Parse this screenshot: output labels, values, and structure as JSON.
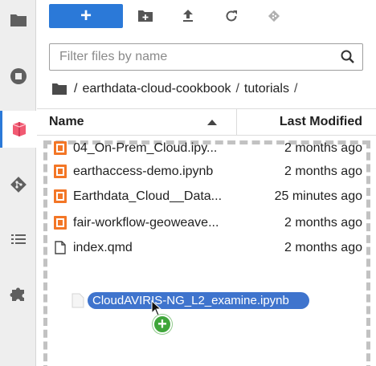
{
  "sidebar": {
    "items": [
      {
        "icon": "folder-icon",
        "active": false
      },
      {
        "icon": "stop-circle-icon",
        "active": false
      },
      {
        "icon": "extension-stack-icon",
        "active": true
      },
      {
        "icon": "git-icon",
        "active": false
      },
      {
        "icon": "list-icon",
        "active": false
      },
      {
        "icon": "puzzle-icon",
        "active": false
      }
    ]
  },
  "toolbar": {
    "new_label": "+",
    "icons": [
      "new-folder-icon",
      "upload-icon",
      "refresh-icon",
      "git-clone-icon"
    ]
  },
  "search": {
    "placeholder": "Filter files by name",
    "value": ""
  },
  "breadcrumb": {
    "root": "/",
    "parts": [
      "earthdata-cloud-cookbook",
      "tutorials"
    ],
    "trailing": "/"
  },
  "columns": {
    "name": "Name",
    "modified": "Last Modified",
    "sort": "ascending"
  },
  "files": [
    {
      "name": "04_On-Prem_Cloud.ipy...",
      "modified": "2 months ago",
      "type": "notebook"
    },
    {
      "name": "earthaccess-demo.ipynb",
      "modified": "2 months ago",
      "type": "notebook"
    },
    {
      "name": "Earthdata_Cloud__Data...",
      "modified": "25 minutes ago",
      "type": "notebook"
    },
    {
      "name": "fair-workflow-geoweave...",
      "modified": "2 months ago",
      "type": "notebook"
    },
    {
      "name": "index.qmd",
      "modified": "2 months ago",
      "type": "file"
    }
  ],
  "drag": {
    "filename": "CloudAVIRIS-NG_L2_examine.ipynb",
    "badge": "+"
  },
  "colors": {
    "accent": "#2b79d8",
    "notebook": "#f37626",
    "drag_pill": "#3f74cd",
    "add_badge": "#3fa63a"
  }
}
